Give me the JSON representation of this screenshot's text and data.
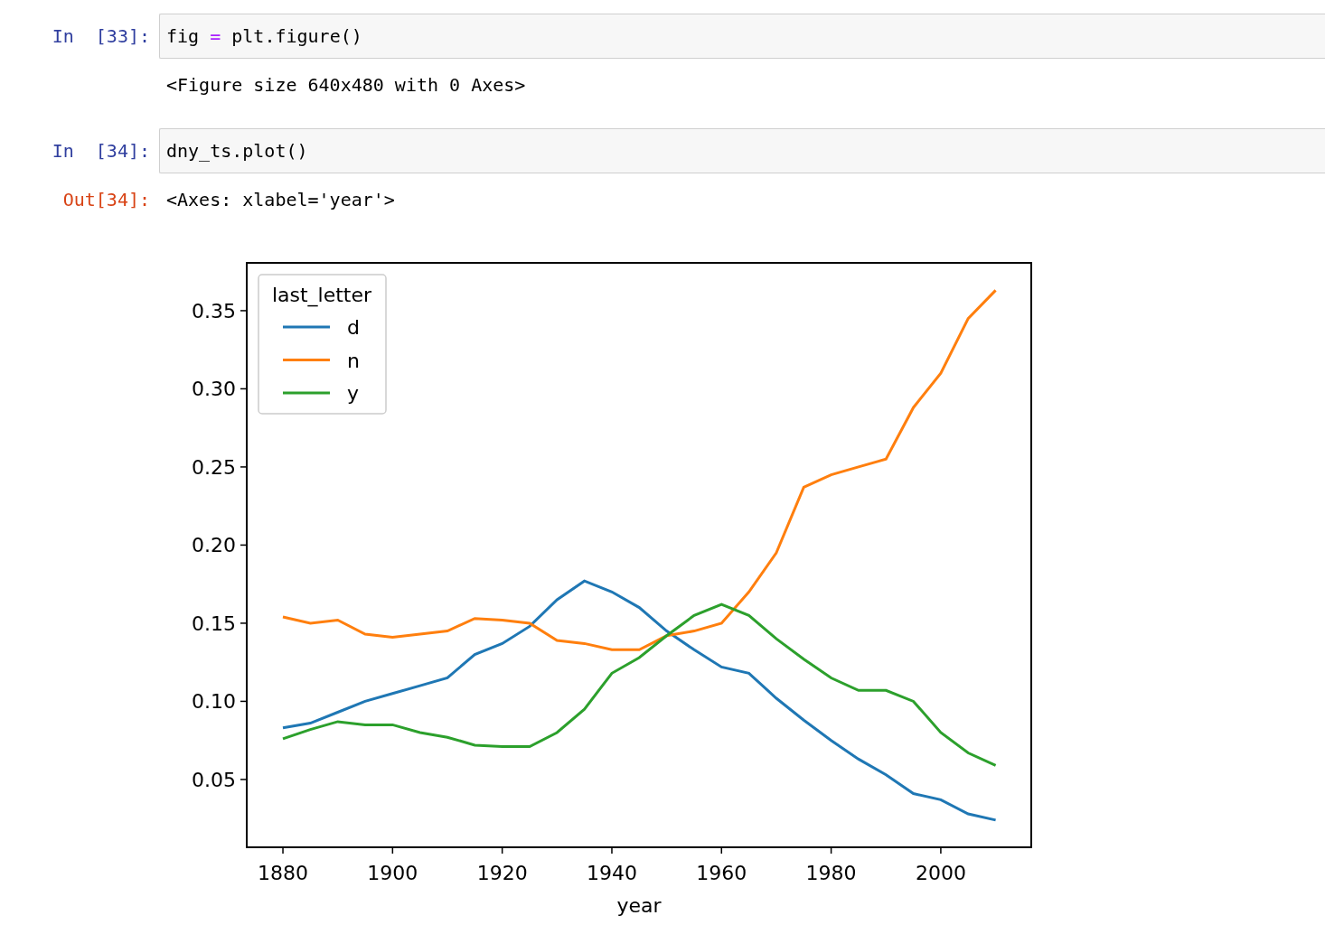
{
  "cells": [
    {
      "kind": "code",
      "prompt": "In [33]:",
      "tokens": [
        {
          "kind": "name",
          "text": "fig "
        },
        {
          "kind": "operator",
          "text": "="
        },
        {
          "kind": "name",
          "text": " plt.figure()"
        }
      ]
    },
    {
      "kind": "text_output",
      "text": "<Figure size 640x480 with 0 Axes>"
    },
    {
      "kind": "code",
      "prompt": "In [34]:",
      "tokens": [
        {
          "kind": "name",
          "text": "dny_ts.plot()"
        }
      ]
    },
    {
      "kind": "text_output",
      "prompt": "Out[34]:",
      "text": "<Axes: xlabel='year'>"
    },
    {
      "kind": "chart_output",
      "chart_data": {
        "type": "line",
        "xlabel": "year",
        "legend": {
          "title": "last_letter"
        },
        "x": [
          1880,
          1885,
          1890,
          1895,
          1900,
          1905,
          1910,
          1915,
          1920,
          1925,
          1930,
          1935,
          1940,
          1945,
          1950,
          1955,
          1960,
          1965,
          1970,
          1975,
          1980,
          1985,
          1990,
          1995,
          2000,
          2005,
          2010
        ],
        "series": [
          {
            "name": "d",
            "color": "#1f77b4",
            "values": [
              0.083,
              0.086,
              0.093,
              0.1,
              0.105,
              0.11,
              0.115,
              0.13,
              0.137,
              0.148,
              0.165,
              0.177,
              0.17,
              0.16,
              0.145,
              0.133,
              0.122,
              0.118,
              0.102,
              0.088,
              0.075,
              0.063,
              0.053,
              0.041,
              0.037,
              0.028,
              0.024
            ]
          },
          {
            "name": "n",
            "color": "#ff7f0e",
            "values": [
              0.154,
              0.15,
              0.152,
              0.143,
              0.141,
              0.143,
              0.145,
              0.153,
              0.152,
              0.15,
              0.139,
              0.137,
              0.133,
              0.133,
              0.142,
              0.145,
              0.15,
              0.17,
              0.195,
              0.237,
              0.245,
              0.25,
              0.255,
              0.288,
              0.31,
              0.345,
              0.363
            ]
          },
          {
            "name": "y",
            "color": "#2ca02c",
            "values": [
              0.076,
              0.082,
              0.087,
              0.085,
              0.085,
              0.08,
              0.077,
              0.072,
              0.071,
              0.071,
              0.08,
              0.095,
              0.118,
              0.128,
              0.142,
              0.155,
              0.162,
              0.155,
              0.14,
              0.127,
              0.115,
              0.107,
              0.107,
              0.1,
              0.08,
              0.067,
              0.059
            ]
          }
        ],
        "xlim": [
          1873.4,
          2016.5
        ],
        "ylim": [
          0.0066,
          0.3806
        ],
        "xticks": [
          1880,
          1900,
          1920,
          1940,
          1960,
          1980,
          2000
        ],
        "yticks": [
          {
            "value": 0.05,
            "label": "0.05"
          },
          {
            "value": 0.1,
            "label": "0.10"
          },
          {
            "value": 0.15,
            "label": "0.15"
          },
          {
            "value": 0.2,
            "label": "0.20"
          },
          {
            "value": 0.25,
            "label": "0.25"
          },
          {
            "value": 0.3,
            "label": "0.30"
          },
          {
            "value": 0.35,
            "label": "0.35"
          }
        ]
      }
    }
  ]
}
